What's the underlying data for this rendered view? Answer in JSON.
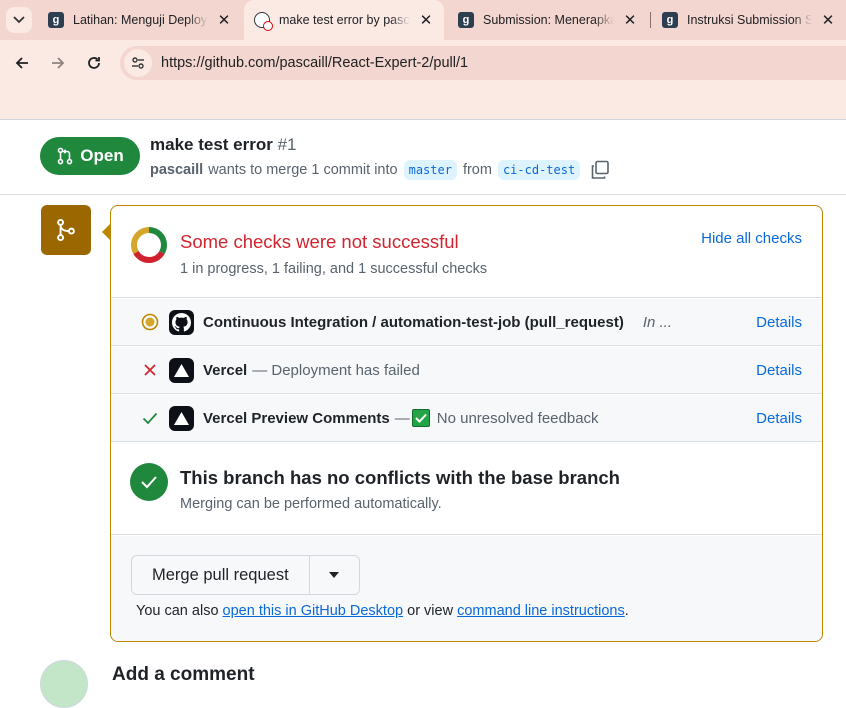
{
  "browser": {
    "tabs": [
      {
        "title": "Latihan: Menguji Deployment",
        "favicon": "dicoding-icon",
        "active": false
      },
      {
        "title": "make test error by pascaill",
        "favicon": "github-error-icon",
        "active": true
      },
      {
        "title": "Submission: Menerapkan",
        "favicon": "dicoding-icon",
        "active": false
      },
      {
        "title": "Instruksi Submission Sub",
        "favicon": "dicoding-icon",
        "active": false
      }
    ],
    "close_glyph": "✕",
    "url": "https://github.com/pascaill/React-Expert-2/pull/1"
  },
  "pr": {
    "state": "Open",
    "title": "make test error",
    "number": "#1",
    "author": "pascaill",
    "merge_text": "wants to merge 1 commit into",
    "base_branch": "master",
    "from_text": "from",
    "head_branch": "ci-cd-test"
  },
  "checks": {
    "title": "Some checks were not successful",
    "summary": "1 in progress, 1 failing, and 1 successful checks",
    "hide_label": "Hide all checks",
    "items": [
      {
        "name": "Continuous Integration / automation-test-job (pull_request)",
        "description": "",
        "eta": "In ...",
        "status": "in-progress",
        "details": "Details"
      },
      {
        "name": "Vercel",
        "description": "— Deployment has failed",
        "eta": "",
        "status": "failure",
        "details": "Details"
      },
      {
        "name": "Vercel Preview Comments",
        "description_prefix": "—",
        "description": "No unresolved feedback",
        "eta": "",
        "status": "success",
        "details": "Details"
      }
    ]
  },
  "branch_status": {
    "title": "This branch has no conflicts with the base branch",
    "subtitle": "Merging can be performed automatically."
  },
  "merge": {
    "button_label": "Merge pull request",
    "also_prefix": "You can also",
    "desktop_link": "open this in GitHub Desktop",
    "or_view": "or view",
    "cli_link": "command line instructions",
    "suffix": "."
  },
  "comment": {
    "heading": "Add a comment"
  },
  "colors": {
    "open_green": "#1f883d",
    "danger_red": "#d1242f",
    "pending_yellow": "#bf8700",
    "link_blue": "#0969da"
  }
}
